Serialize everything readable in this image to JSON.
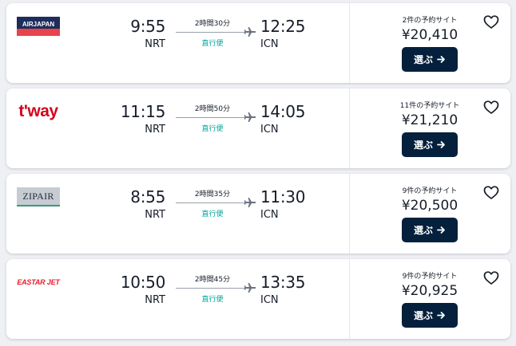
{
  "flights": [
    {
      "airline_logo_text": "AIRJAPAN",
      "logo_style": "airjapan",
      "dep_time": "9:55",
      "dep_code": "NRT",
      "duration": "2時間30分",
      "stops": "直行便",
      "arr_time": "12:25",
      "arr_code": "ICN",
      "sites": "2件の予約サイト",
      "price": "¥20,410",
      "select_label": "選ぶ"
    },
    {
      "airline_logo_text": "t'way",
      "logo_style": "tway",
      "dep_time": "11:15",
      "dep_code": "NRT",
      "duration": "2時間50分",
      "stops": "直行便",
      "arr_time": "14:05",
      "arr_code": "ICN",
      "sites": "11件の予約サイト",
      "price": "¥21,210",
      "select_label": "選ぶ"
    },
    {
      "airline_logo_text": "ZIPAIR",
      "logo_style": "zipair",
      "dep_time": "8:55",
      "dep_code": "NRT",
      "duration": "2時間35分",
      "stops": "直行便",
      "arr_time": "11:30",
      "arr_code": "ICN",
      "sites": "9件の予約サイト",
      "price": "¥20,500",
      "select_label": "選ぶ"
    },
    {
      "airline_logo_text": "EASTAR JET",
      "logo_style": "eastar",
      "dep_time": "10:50",
      "dep_code": "NRT",
      "duration": "2時間45分",
      "stops": "直行便",
      "arr_time": "13:35",
      "arr_code": "ICN",
      "sites": "9件の予約サイト",
      "price": "¥20,925",
      "select_label": "選ぶ"
    }
  ],
  "colors": {
    "button_bg": "#05203c",
    "nonstop": "#00a698",
    "tway_red": "#d6001c",
    "airjapan_navy": "#1d2d5c",
    "airjapan_red": "#e8434a",
    "eastar_red": "#e41e2b"
  },
  "icons": {
    "plane": "plane-icon",
    "arrow": "arrow-right-icon",
    "favorite": "heart-icon"
  }
}
